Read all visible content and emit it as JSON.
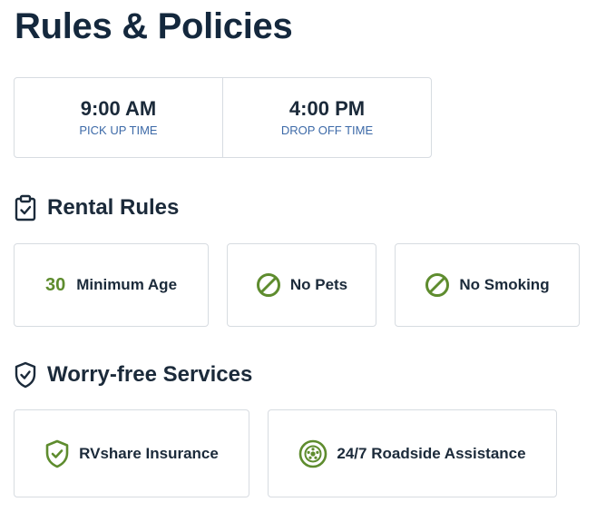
{
  "page": {
    "title": "Rules & Policies"
  },
  "times": {
    "pickup": {
      "value": "9:00 AM",
      "label": "PICK UP TIME"
    },
    "dropoff": {
      "value": "4:00 PM",
      "label": "DROP OFF TIME"
    }
  },
  "rental_rules": {
    "heading": "Rental Rules",
    "icon": "clipboard-check-icon",
    "items": [
      {
        "number": "30",
        "label": "Minimum Age"
      },
      {
        "icon": "prohibited-icon",
        "label": "No Pets"
      },
      {
        "icon": "prohibited-icon",
        "label": "No Smoking"
      }
    ]
  },
  "services": {
    "heading": "Worry-free Services",
    "icon": "shield-check-icon",
    "items": [
      {
        "icon": "shield-check-icon",
        "label": "RVshare Insurance"
      },
      {
        "icon": "tire-icon",
        "label": "24/7 Roadside Assistance"
      }
    ]
  },
  "colors": {
    "accent_green": "#5e8c2e",
    "label_blue": "#3d6aa8",
    "heading": "#14283d",
    "border": "#d7dce1"
  }
}
